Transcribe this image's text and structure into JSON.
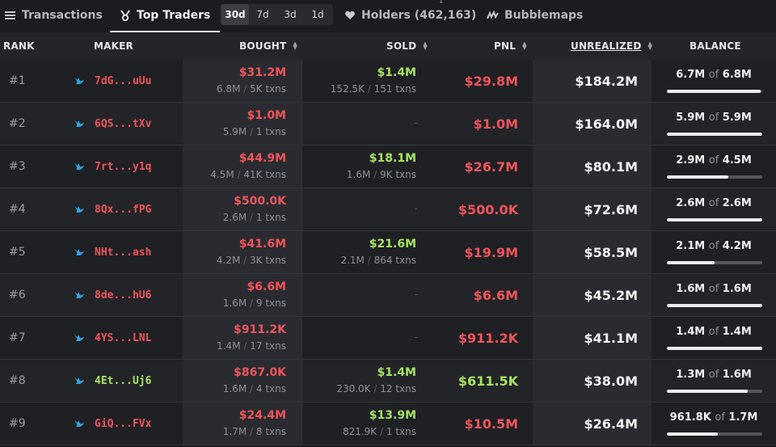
{
  "tabs": [
    {
      "label": "Transactions",
      "icon": "list-icon"
    },
    {
      "label": "Top Traders",
      "icon": "medal-icon"
    },
    {
      "label": "Holders (462,163)",
      "icon": "heart-icon"
    },
    {
      "label": "Bubblemaps",
      "icon": "bubblemaps-icon"
    }
  ],
  "periods": [
    "30d",
    "7d",
    "3d",
    "1d"
  ],
  "selected_period": "30d",
  "columns": {
    "rank": "RANK",
    "maker": "MAKER",
    "bought": "BOUGHT",
    "sold": "SOLD",
    "pnl": "PNL",
    "unrealized": "UNREALIZED",
    "balance": "BALANCE"
  },
  "colors": {
    "negative": "#f0535a",
    "positive": "#a6e35e",
    "whale": "#2fa6e8"
  },
  "rows": [
    {
      "rank": "#1",
      "maker": "7dG...uUu",
      "maker_color": "#f0535a",
      "bought_amt": "$31.2M",
      "bought_tokens": "6.8M",
      "bought_txns": "5K txns",
      "sold_amt": "$1.4M",
      "sold_tokens": "152.5K",
      "sold_txns": "151 txns",
      "pnl": "$29.8M",
      "pnl_color": "#f0535a",
      "unrealized": "$184.2M",
      "bal_held": "6.7M",
      "bal_of": "of",
      "bal_total": "6.8M",
      "bal_fraction": 0.98
    },
    {
      "rank": "#2",
      "maker": "6QS...tXv",
      "maker_color": "#f0535a",
      "bought_amt": "$1.0M",
      "bought_tokens": "5.9M",
      "bought_txns": "1 txns",
      "sold_dash": "-",
      "pnl": "$1.0M",
      "pnl_color": "#f0535a",
      "unrealized": "$164.0M",
      "bal_held": "5.9M",
      "bal_of": "of",
      "bal_total": "5.9M",
      "bal_fraction": 1.0
    },
    {
      "rank": "#3",
      "maker": "7rt...y1q",
      "maker_color": "#f0535a",
      "bought_amt": "$44.9M",
      "bought_tokens": "4.5M",
      "bought_txns": "41K txns",
      "sold_amt": "$18.1M",
      "sold_tokens": "1.6M",
      "sold_txns": "9K txns",
      "pnl": "$26.7M",
      "pnl_color": "#f0535a",
      "unrealized": "$80.1M",
      "bal_held": "2.9M",
      "bal_of": "of",
      "bal_total": "4.5M",
      "bal_fraction": 0.64
    },
    {
      "rank": "#4",
      "maker": "8Qx...fPG",
      "maker_color": "#f0535a",
      "bought_amt": "$500.0K",
      "bought_tokens": "2.6M",
      "bought_txns": "1 txns",
      "sold_dash": "-",
      "pnl": "$500.0K",
      "pnl_color": "#f0535a",
      "unrealized": "$72.6M",
      "bal_held": "2.6M",
      "bal_of": "of",
      "bal_total": "2.6M",
      "bal_fraction": 1.0
    },
    {
      "rank": "#5",
      "maker": "NHt...ash",
      "maker_color": "#f0535a",
      "bought_amt": "$41.6M",
      "bought_tokens": "4.2M",
      "bought_txns": "3K txns",
      "sold_amt": "$21.6M",
      "sold_tokens": "2.1M",
      "sold_txns": "864 txns",
      "pnl": "$19.9M",
      "pnl_color": "#f0535a",
      "unrealized": "$58.5M",
      "bal_held": "2.1M",
      "bal_of": "of",
      "bal_total": "4.2M",
      "bal_fraction": 0.5
    },
    {
      "rank": "#6",
      "maker": "8de...hU6",
      "maker_color": "#f0535a",
      "bought_amt": "$6.6M",
      "bought_tokens": "1.6M",
      "bought_txns": "9 txns",
      "sold_dash": "-",
      "pnl": "$6.6M",
      "pnl_color": "#f0535a",
      "unrealized": "$45.2M",
      "bal_held": "1.6M",
      "bal_of": "of",
      "bal_total": "1.6M",
      "bal_fraction": 1.0
    },
    {
      "rank": "#7",
      "maker": "4YS...LNL",
      "maker_color": "#f0535a",
      "bought_amt": "$911.2K",
      "bought_tokens": "1.4M",
      "bought_txns": "17 txns",
      "sold_dash": "-",
      "pnl": "$911.2K",
      "pnl_color": "#f0535a",
      "unrealized": "$41.1M",
      "bal_held": "1.4M",
      "bal_of": "of",
      "bal_total": "1.4M",
      "bal_fraction": 1.0
    },
    {
      "rank": "#8",
      "maker": "4Et...Uj6",
      "maker_color": "#a6e35e",
      "bought_amt": "$867.0K",
      "bought_tokens": "1.6M",
      "bought_txns": "4 txns",
      "sold_amt": "$1.4M",
      "sold_tokens": "230.0K",
      "sold_txns": "12 txns",
      "pnl": "$611.5K",
      "pnl_color": "#a6e35e",
      "unrealized": "$38.0M",
      "bal_held": "1.3M",
      "bal_of": "of",
      "bal_total": "1.6M",
      "bal_fraction": 0.85
    },
    {
      "rank": "#9",
      "maker": "GiQ...FVx",
      "maker_color": "#f0535a",
      "bought_amt": "$24.4M",
      "bought_tokens": "1.7M",
      "bought_txns": "8 txns",
      "sold_amt": "$13.9M",
      "sold_tokens": "821.9K",
      "sold_txns": "1 txns",
      "pnl": "$10.5M",
      "pnl_color": "#f0535a",
      "unrealized": "$26.4M",
      "bal_held": "961.8K",
      "bal_of": "of",
      "bal_total": "1.7M",
      "bal_fraction": 0.53
    }
  ]
}
